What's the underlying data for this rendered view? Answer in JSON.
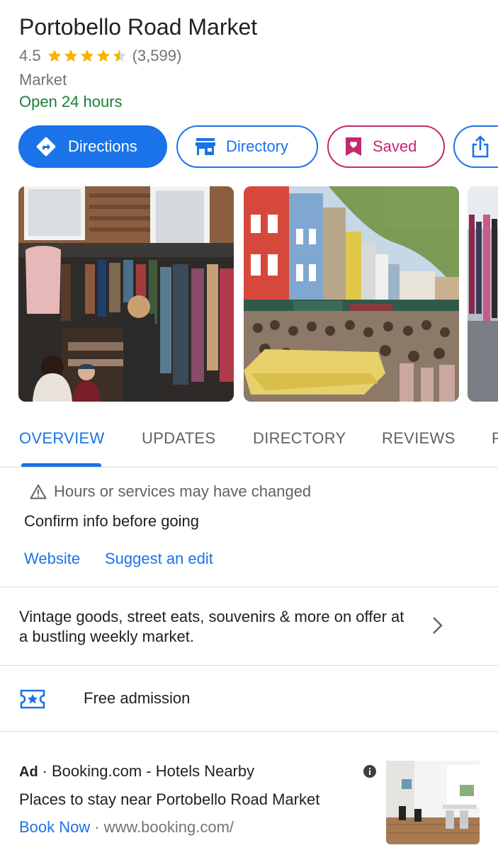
{
  "place": {
    "title": "Portobello Road Market",
    "rating": "4.5",
    "stars_value": 4.5,
    "reviews_count": "(3,599)",
    "category": "Market",
    "open_status": "Open 24 hours"
  },
  "actions": {
    "directions_label": "Directions",
    "directory_label": "Directory",
    "saved_label": "Saved"
  },
  "tabs": [
    "OVERVIEW",
    "UPDATES",
    "DIRECTORY",
    "REVIEWS",
    "P"
  ],
  "active_tab": "OVERVIEW",
  "notice": {
    "title": "Hours or services may have changed",
    "subtitle": "Confirm info before going",
    "website_link": "Website",
    "suggest_edit_link": "Suggest an edit"
  },
  "description": "Vintage goods, street eats, souvenirs & more on offer at a bustling weekly market.",
  "admission": "Free admission",
  "ad": {
    "badge": "Ad",
    "separator": "·",
    "headline": "Booking.com - Hotels Nearby",
    "body": "Places to stay near Portobello Road Market",
    "cta": "Book Now",
    "dot": "·",
    "url": "www.booking.com/"
  },
  "colors": {
    "accent": "#1a73e8",
    "saved": "#c5286f",
    "open": "#188038",
    "star": "#f4b400",
    "muted": "#70757a"
  },
  "icons": [
    "directions-icon",
    "storefront-icon",
    "bookmark-heart-icon",
    "share-icon",
    "warning-icon",
    "chevron-right-icon",
    "ticket-star-icon",
    "info-icon",
    "star-icon"
  ]
}
